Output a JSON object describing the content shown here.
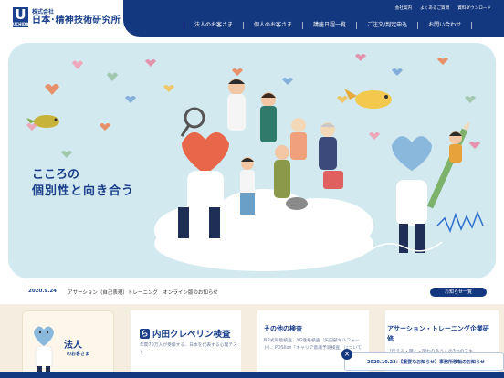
{
  "logo": {
    "mark": "U",
    "mark_sub": "UCHIDA",
    "company_small": "株式会社",
    "company_name": "日本･精神技術研究所"
  },
  "utility_links": [
    "会社案内",
    "よくあるご質問",
    "資料ダウンロード"
  ],
  "nav": [
    "法人のお客さま",
    "個人のお客さま",
    "講座日程一覧",
    "ご注文/判定申込",
    "お問い合わせ"
  ],
  "hero": {
    "tagline_line1": "こころの",
    "tagline_line2": "個別性と向き合う",
    "bg_color": "#d2e9f0"
  },
  "news": {
    "date": "2020.9.24",
    "text": "アサーション（自己表現）トレーニング　オンライン版のお知らせ",
    "button": "お知らせ一覧"
  },
  "cards": {
    "corporate": {
      "title": "法人",
      "subtitle": "のお客さま"
    },
    "uchida": {
      "mark": "ら",
      "name": "内田クレペリン検査",
      "desc": "年間70万人が受検する、日本を代表する心理テスト"
    },
    "other": {
      "title": "その他の検査",
      "desc": "NR式知能検査、YG性格検査（矢田部ギルフォード）、POSIion「キャリア意識予測検査」について"
    },
    "training": {
      "title": "アサーション・トレーニング企業研修",
      "desc": "「伝える・聴く・関わりあう」の3つのスキ"
    }
  },
  "notice": {
    "text": "2020.10.22：【重要なお知らせ】事務所移転のお知らせ",
    "close": "×"
  },
  "colors": {
    "navy": "#14387f",
    "brand_blue": "#1b3f8b",
    "cream": "#f4ede0"
  }
}
